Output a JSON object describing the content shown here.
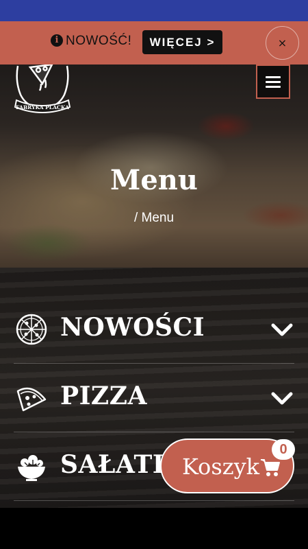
{
  "notice": {
    "info_icon": "info-circle-icon",
    "text": "NOWOŚĆ!",
    "more_label": "WIĘCEJ >",
    "close_label": "×"
  },
  "header": {
    "logo_text": "FABRYKA PLACKA",
    "menu_icon": "hamburger-icon"
  },
  "hero": {
    "title": "Menu",
    "breadcrumb": "/  Menu"
  },
  "categories": [
    {
      "label": "NOWOŚCI",
      "icon": "pizza-whole-icon"
    },
    {
      "label": "PIZZA",
      "icon": "pizza-slice-icon"
    },
    {
      "label": "SAŁATKI",
      "icon": "salad-bowl-icon"
    }
  ],
  "cart": {
    "label": "Koszyk",
    "icon": "cart-icon",
    "count": "0"
  },
  "colors": {
    "status_bar": "#2d3ea0",
    "accent": "#c2604f",
    "dark": "#111111"
  }
}
